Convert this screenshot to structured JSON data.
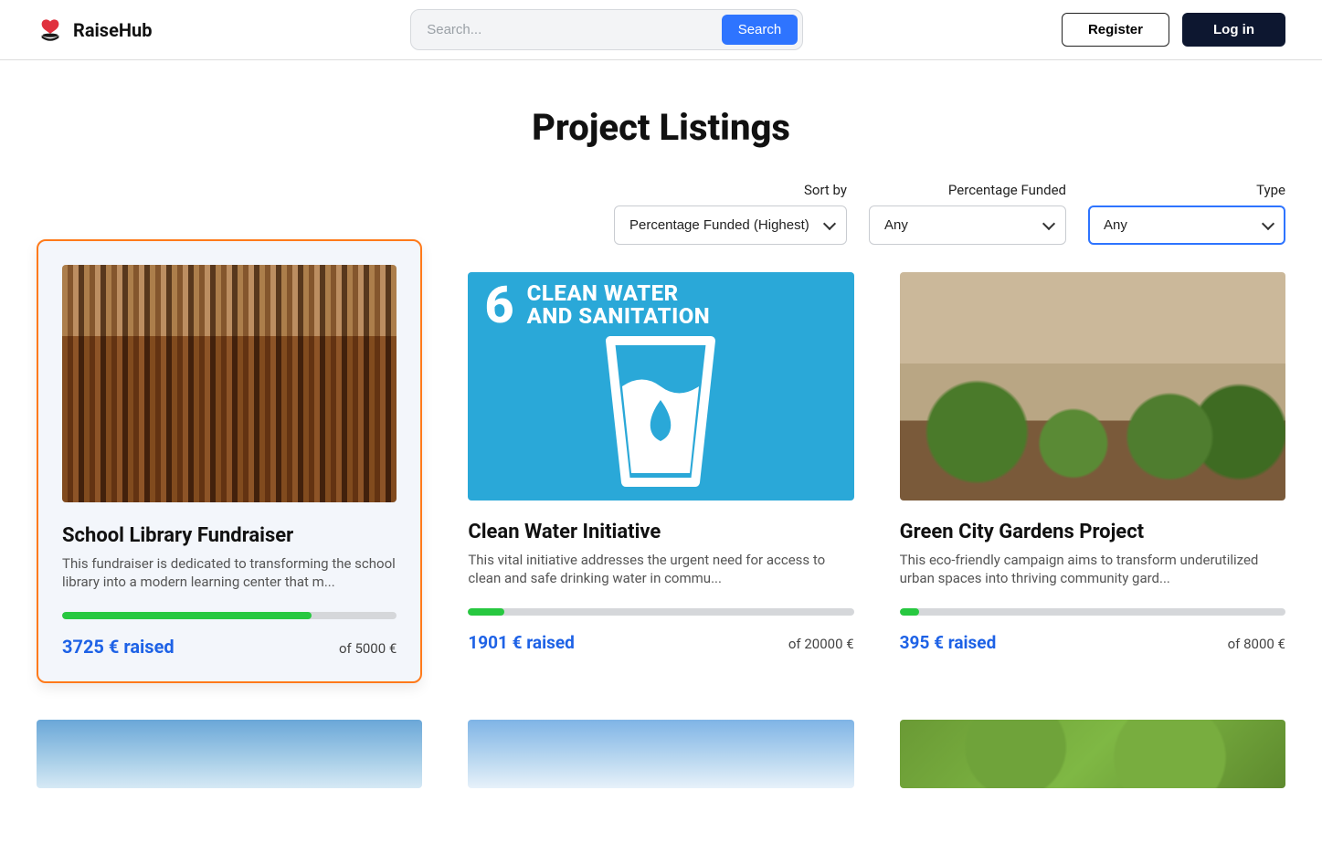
{
  "brand": {
    "name": "RaiseHub"
  },
  "search": {
    "placeholder": "Search...",
    "button": "Search"
  },
  "auth": {
    "register": "Register",
    "login": "Log in"
  },
  "page": {
    "title": "Project Listings"
  },
  "filters": {
    "sort": {
      "label": "Sort by",
      "selected": "Percentage Funded (Highest)"
    },
    "percentage": {
      "label": "Percentage Funded",
      "selected": "Any"
    },
    "type": {
      "label": "Type",
      "selected": "Any"
    }
  },
  "currency": "€",
  "raised_word": "raised",
  "of_word": "of",
  "projects": [
    {
      "title": "School Library Fundraiser",
      "desc": "This fundraiser is dedicated to transforming the school library into a modern learning center that m...",
      "raised": 3725,
      "goal": 5000,
      "imgclass": "img-library",
      "highlight": true
    },
    {
      "title": "Clean Water Initiative",
      "desc": "This vital initiative addresses the urgent need for access to clean and safe drinking water in commu...",
      "raised": 1901,
      "goal": 20000,
      "imgclass": "img-water",
      "highlight": false,
      "water_big": "6",
      "water_line1": "CLEAN WATER",
      "water_line2": "AND SANITATION"
    },
    {
      "title": "Green City Gardens Project",
      "desc": "This eco-friendly campaign aims to transform underutilized urban spaces into thriving community gard...",
      "raised": 395,
      "goal": 8000,
      "imgclass": "img-garden",
      "highlight": false
    },
    {
      "title": "",
      "desc": "",
      "raised": null,
      "goal": null,
      "imgclass": "img-wind",
      "highlight": false,
      "partial": true
    },
    {
      "title": "",
      "desc": "",
      "raised": null,
      "goal": null,
      "imgclass": "img-church",
      "highlight": false,
      "partial": true
    },
    {
      "title": "",
      "desc": "",
      "raised": null,
      "goal": null,
      "imgclass": "img-aerial",
      "highlight": false,
      "partial": true
    }
  ]
}
